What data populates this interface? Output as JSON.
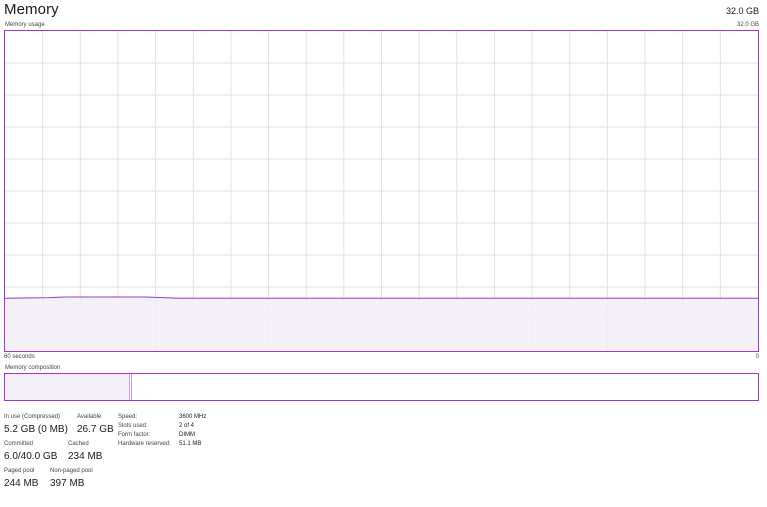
{
  "header": {
    "title": "Memory",
    "total": "32.0 GB"
  },
  "usage_graph": {
    "label": "Memory usage",
    "max_label": "32.0 GB",
    "x_left_label": "60 seconds",
    "x_right_label": "0",
    "line_color": "#9b37c9",
    "fill_color": "#f3eff7",
    "grid_color": "#e6dcef",
    "usage_fraction": 0.165
  },
  "composition": {
    "label": "Memory composition"
  },
  "stats": {
    "in_use_label": "In use (Compressed)",
    "in_use_value": "5.2 GB (0 MB)",
    "available_label": "Available",
    "available_value": "26.7 GB",
    "committed_label": "Committed",
    "committed_value": "6.0/40.0 GB",
    "cached_label": "Cached",
    "cached_value": "234 MB",
    "paged_pool_label": "Paged pool",
    "paged_pool_value": "244 MB",
    "non_paged_pool_label": "Non-paged pool",
    "non_paged_pool_value": "397 MB"
  },
  "details": [
    {
      "key": "Speed:",
      "value": "3600 MHz"
    },
    {
      "key": "Slots used:",
      "value": "2 of 4"
    },
    {
      "key": "Form factor:",
      "value": "DIMM"
    },
    {
      "key": "Hardware reserved:",
      "value": "51.1 MB"
    }
  ]
}
